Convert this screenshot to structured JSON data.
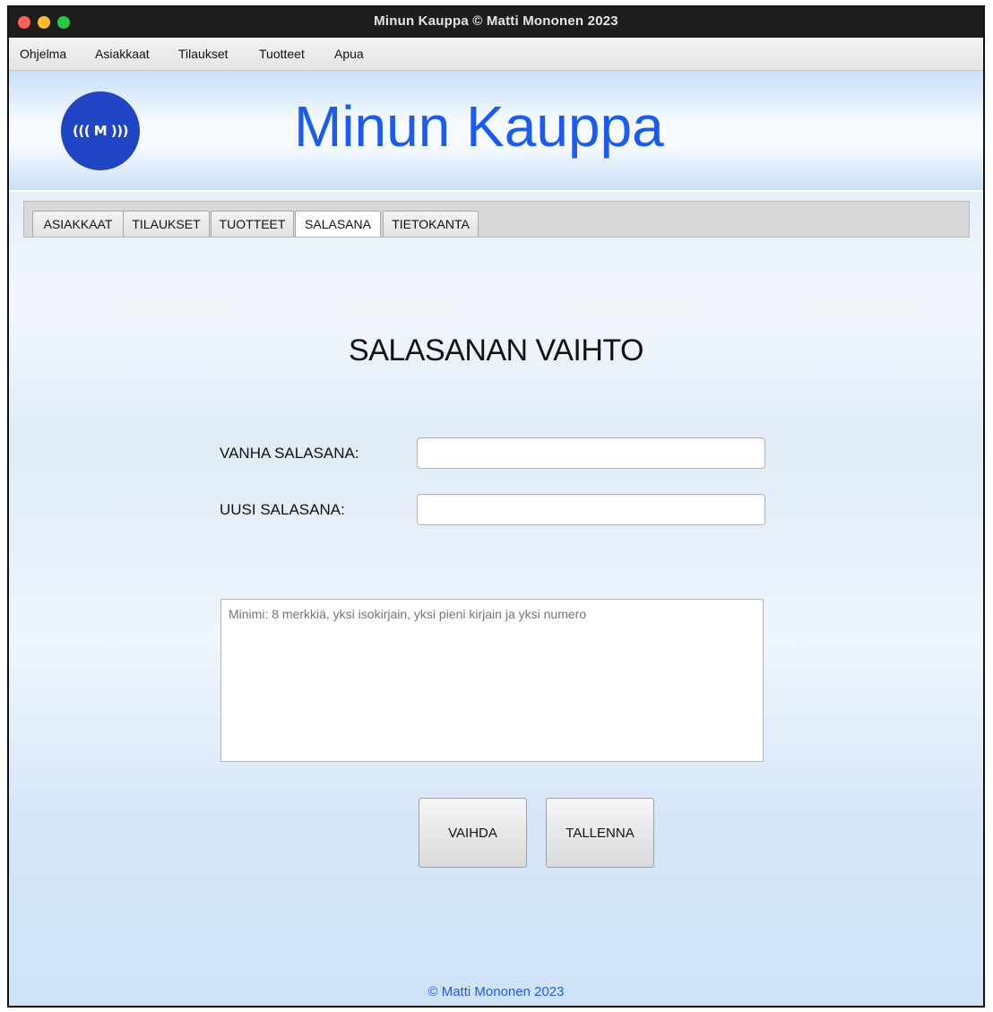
{
  "window": {
    "title": "Minun Kauppa © Matti Mononen 2023"
  },
  "menu": [
    {
      "label": "Ohjelma"
    },
    {
      "label": "Asiakkaat"
    },
    {
      "label": "Tilaukset"
    },
    {
      "label": "Tuotteet"
    },
    {
      "label": "Apua"
    }
  ],
  "header": {
    "logo_text": "((( M )))",
    "app_title": "Minun Kauppa"
  },
  "tabs": [
    {
      "label": "ASIAKKAAT"
    },
    {
      "label": "TILAUKSET"
    },
    {
      "label": "TUOTTEET"
    },
    {
      "label": "SALASANA"
    },
    {
      "label": "TIETOKANTA"
    }
  ],
  "active_tab": "SALASANA",
  "form": {
    "title": "SALASANAN VAIHTO",
    "old_password_label": "VANHA SALASANA:",
    "old_password_value": "",
    "new_password_label": "UUSI SALASANA:",
    "new_password_value": "",
    "info_placeholder": "Minimi: 8 merkkiä, yksi isokirjain, yksi pieni kirjain ja yksi numero",
    "change_button": "VAIHDA",
    "save_button": "TALLENNA"
  },
  "footer": {
    "text": "© Matti Mononen 2023"
  },
  "colors": {
    "accent": "#1a5cf2",
    "logo": "#1f44c4"
  }
}
